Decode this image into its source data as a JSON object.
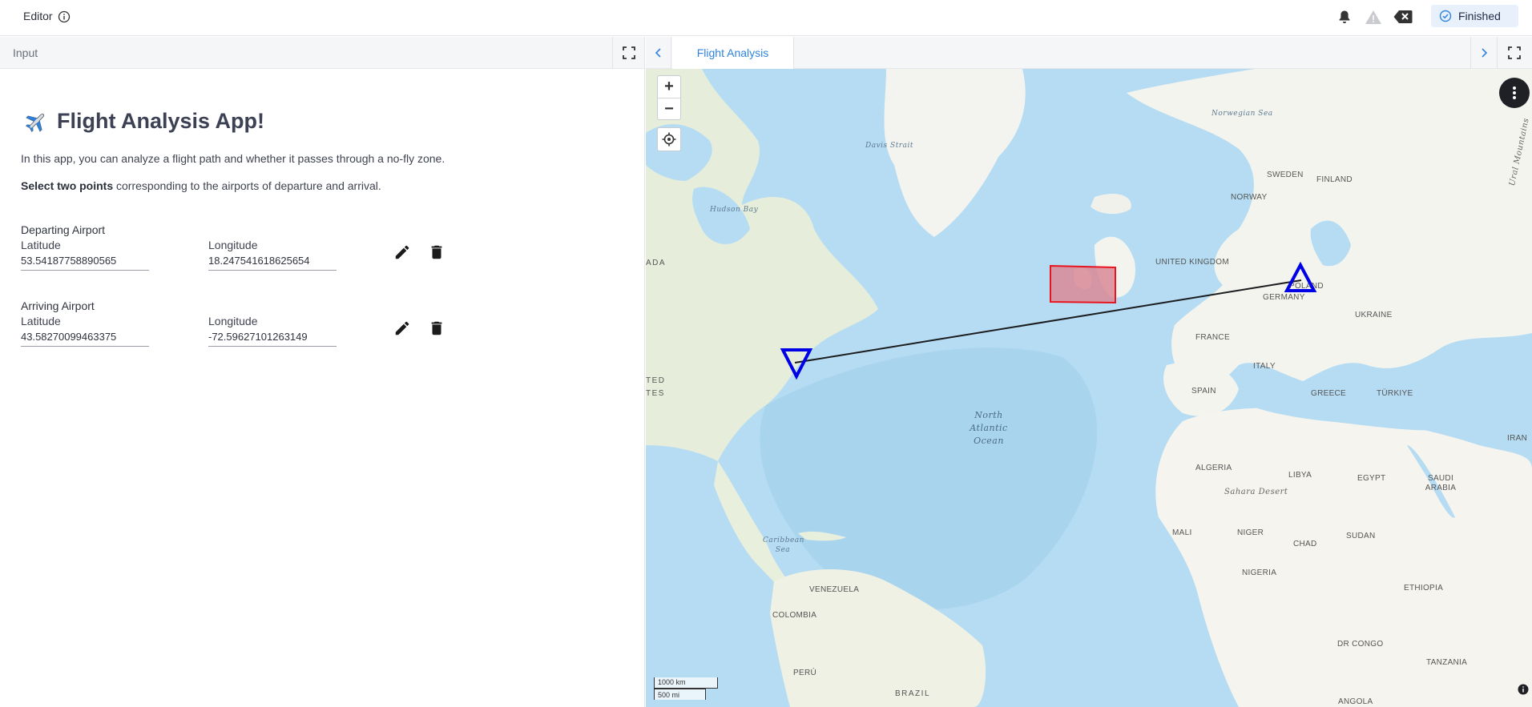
{
  "header": {
    "title": "Editor",
    "status": "Finished"
  },
  "left": {
    "panel_label": "Input",
    "app_title": "Flight Analysis App!",
    "intro": "In this app, you can analyze a flight path and whether it passes through a no-fly zone.",
    "instruction_bold": "Select two points",
    "instruction_rest": " corresponding to the airports of departure and arrival.",
    "departing": {
      "label": "Departing Airport",
      "lat_label": "Latitude",
      "lat_value": "53.54187758890565",
      "lon_label": "Longitude",
      "lon_value": "18.247541618625654"
    },
    "arriving": {
      "label": "Arriving Airport",
      "lat_label": "Latitude",
      "lat_value": "43.58270099463375",
      "lon_label": "Longitude",
      "lon_value": "-72.59627101263149"
    }
  },
  "right": {
    "tab": "Flight Analysis",
    "scale_km": "1000 km",
    "scale_mi": "500 mi",
    "labels": {
      "davis_strait": "Davis Strait",
      "hudson_bay": "Hudson Bay",
      "norwegian_sea": "Norwegian Sea",
      "sweden": "SWEDEN",
      "finland": "FINLAND",
      "norway": "NORWAY",
      "united_kingdom": "UNITED KINGDOM",
      "germany": "GERMANY",
      "poland": "POLAND",
      "ukraine": "UKRAINE",
      "france": "FRANCE",
      "italy": "ITALY",
      "spain": "SPAIN",
      "greece": "GREECE",
      "turkiye": "TÜRKIYE",
      "iran": "IRAN",
      "north_atlantic": "North Atlantic Ocean",
      "algeria": "ALGERIA",
      "libya": "LIBYA",
      "egypt": "EGYPT",
      "saudi_arabia": "SAUDI ARABIA",
      "sahara": "Sahara Desert",
      "mali": "MALI",
      "niger": "NIGER",
      "chad": "CHAD",
      "sudan": "SUDAN",
      "nigeria": "NIGERIA",
      "ethiopia": "ETHIOPIA",
      "caribbean": "Caribbean Sea",
      "venezuela": "VENEZUELA",
      "colombia": "COLOMBIA",
      "peru": "PERÚ",
      "brazil": "BRAZIL",
      "dr_congo": "DR CONGO",
      "tanzania": "TANZANIA",
      "angola": "ANGOLA",
      "canada_frag": "ADA",
      "us_frag_1": "TED",
      "us_frag_2": "TES",
      "ural": "Ural Mountains"
    }
  },
  "colors": {
    "accent": "#2f84e0",
    "marker": "#0000e6",
    "nofly_fill": "#d98a96",
    "nofly_stroke": "#e8141e",
    "ocean": "#b5dcf2",
    "land": "#f1f1ec"
  }
}
